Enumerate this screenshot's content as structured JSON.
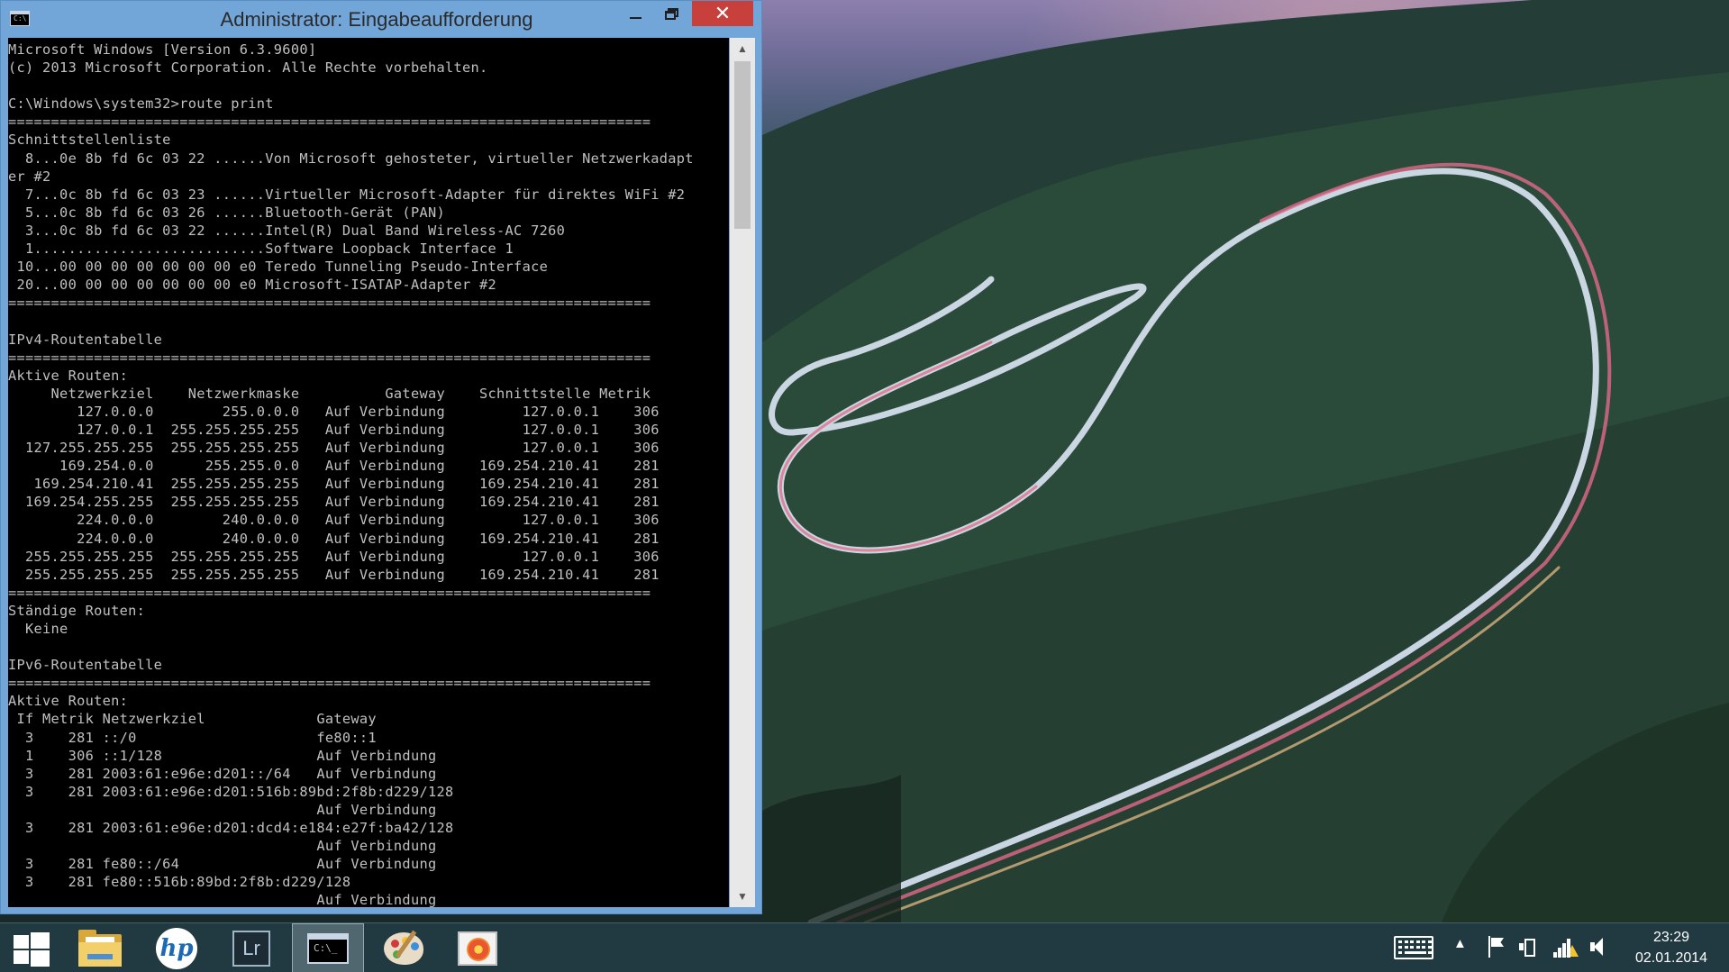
{
  "window": {
    "title": "Administrator: Eingabeaufforderung",
    "icon_text": "C:\\",
    "min_icon": "minimize-icon",
    "max_icon": "restore-icon",
    "close_icon": "close-icon",
    "close_glyph": "✕",
    "accent_color": "#72a5d8",
    "close_color": "#c7403b"
  },
  "console": {
    "lines": [
      "Microsoft Windows [Version 6.3.9600]",
      "(c) 2013 Microsoft Corporation. Alle Rechte vorbehalten.",
      "",
      "C:\\Windows\\system32>route print",
      "===========================================================================",
      "Schnittstellenliste",
      "  8...0e 8b fd 6c 03 22 ......Von Microsoft gehosteter, virtueller Netzwerkadapt",
      "er #2",
      "  7...0c 8b fd 6c 03 23 ......Virtueller Microsoft-Adapter für direktes WiFi #2",
      "  5...0c 8b fd 6c 03 26 ......Bluetooth-Gerät (PAN)",
      "  3...0c 8b fd 6c 03 22 ......Intel(R) Dual Band Wireless-AC 7260",
      "  1...........................Software Loopback Interface 1",
      " 10...00 00 00 00 00 00 00 e0 Teredo Tunneling Pseudo-Interface",
      " 20...00 00 00 00 00 00 00 e0 Microsoft-ISATAP-Adapter #2",
      "===========================================================================",
      "",
      "IPv4-Routentabelle",
      "===========================================================================",
      "Aktive Routen:",
      "     Netzwerkziel    Netzwerkmaske          Gateway    Schnittstelle Metrik",
      "        127.0.0.0        255.0.0.0   Auf Verbindung         127.0.0.1    306",
      "        127.0.0.1  255.255.255.255   Auf Verbindung         127.0.0.1    306",
      "  127.255.255.255  255.255.255.255   Auf Verbindung         127.0.0.1    306",
      "      169.254.0.0      255.255.0.0   Auf Verbindung    169.254.210.41    281",
      "   169.254.210.41  255.255.255.255   Auf Verbindung    169.254.210.41    281",
      "  169.254.255.255  255.255.255.255   Auf Verbindung    169.254.210.41    281",
      "        224.0.0.0        240.0.0.0   Auf Verbindung         127.0.0.1    306",
      "        224.0.0.0        240.0.0.0   Auf Verbindung    169.254.210.41    281",
      "  255.255.255.255  255.255.255.255   Auf Verbindung         127.0.0.1    306",
      "  255.255.255.255  255.255.255.255   Auf Verbindung    169.254.210.41    281",
      "===========================================================================",
      "Ständige Routen:",
      "  Keine",
      "",
      "IPv6-Routentabelle",
      "===========================================================================",
      "Aktive Routen:",
      " If Metrik Netzwerkziel             Gateway",
      "  3    281 ::/0                     fe80::1",
      "  1    306 ::1/128                  Auf Verbindung",
      "  3    281 2003:61:e96e:d201::/64   Auf Verbindung",
      "  3    281 2003:61:e96e:d201:516b:89bd:2f8b:d229/128",
      "                                    Auf Verbindung",
      "  3    281 2003:61:e96e:d201:dcd4:e184:e27f:ba42/128",
      "                                    Auf Verbindung",
      "  3    281 fe80::/64                Auf Verbindung",
      "  3    281 fe80::516b:89bd:2f8b:d229/128",
      "                                    Auf Verbindung"
    ],
    "text_color": "#c0c0c0",
    "background": "#000000"
  },
  "scrollbar": {
    "up_glyph": "▲",
    "down_glyph": "▼"
  },
  "taskbar": {
    "items": [
      {
        "name": "start",
        "icon": "windows-logo-icon"
      },
      {
        "name": "file-explorer",
        "icon": "folder-icon"
      },
      {
        "name": "hp",
        "icon": "hp-logo-icon",
        "text": "hp"
      },
      {
        "name": "lightroom",
        "icon": "lightroom-icon",
        "text": "Lr"
      },
      {
        "name": "command-prompt",
        "icon": "cmd-icon",
        "text": "C:\\_",
        "active": true
      },
      {
        "name": "paint",
        "icon": "palette-icon"
      },
      {
        "name": "photo-gallery",
        "icon": "photo-icon"
      }
    ],
    "tray": {
      "chevron_glyph": "▲",
      "icons": [
        "keyboard-icon",
        "chevron-up-icon",
        "action-center-flag-icon",
        "power-icon",
        "network-icon",
        "volume-icon"
      ],
      "time": "23:29",
      "date": "02.01.2014"
    }
  }
}
